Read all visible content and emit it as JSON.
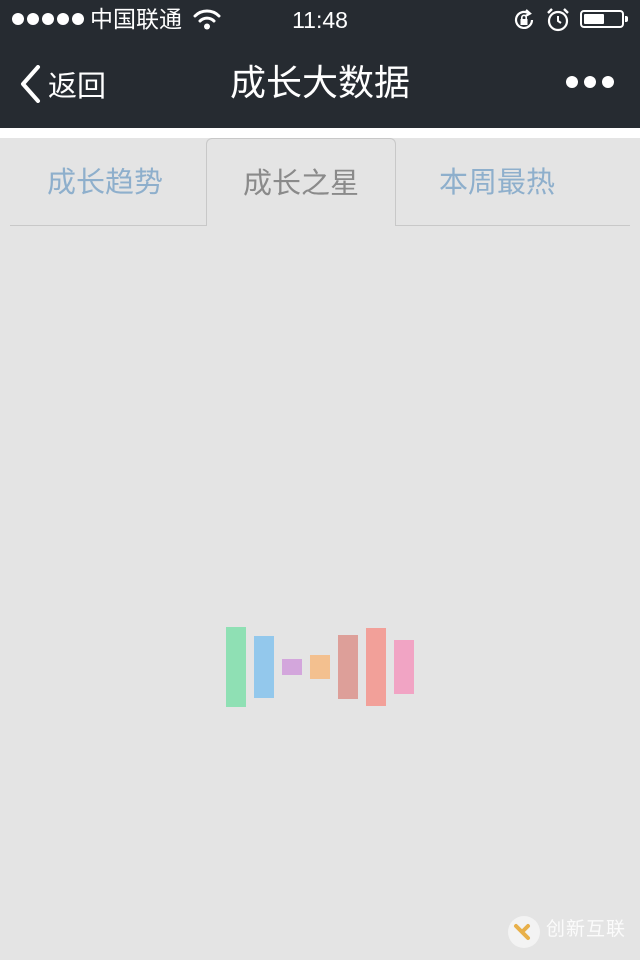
{
  "status_bar": {
    "carrier": "中国联通",
    "time": "11:48",
    "battery_level": 0.55
  },
  "nav": {
    "back_label": "返回",
    "title": "成长大数据"
  },
  "tabs": [
    {
      "label": "成长趋势",
      "active": false
    },
    {
      "label": "成长之星",
      "active": true
    },
    {
      "label": "本周最热",
      "active": false
    }
  ],
  "loader": {
    "bar_colors": [
      "#8fe0b4",
      "#93c8ec",
      "#d3a6dc",
      "#f3c08f",
      "#dd9f99",
      "#f2a099",
      "#f1a4c4"
    ],
    "bar_heights": [
      80,
      62,
      16,
      24,
      64,
      78,
      54
    ]
  },
  "watermark": {
    "text": "创新互联"
  },
  "colors": {
    "bar_background": "#262b31",
    "page_background": "#e4e4e4",
    "tab_inactive_text": "#8eafcc",
    "tab_active_text": "#8a8a8a"
  },
  "icons": {
    "signal": "signal-dots-icon",
    "wifi": "wifi-icon",
    "rotation_lock": "rotation-lock-icon",
    "alarm": "alarm-clock-icon",
    "battery": "battery-icon",
    "back": "chevron-left-icon",
    "more": "more-dots-icon"
  }
}
